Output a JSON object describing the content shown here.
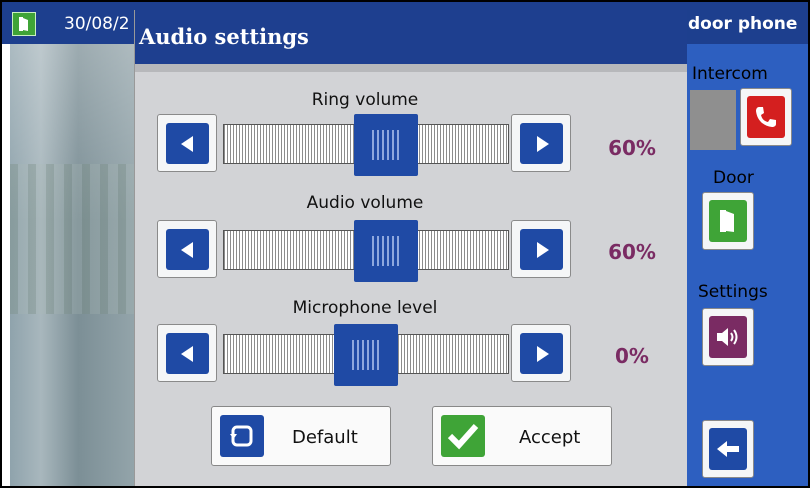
{
  "topbar": {
    "date": "30/08/2",
    "device": "door phone"
  },
  "dialog": {
    "title": "Audio settings"
  },
  "sliders": [
    {
      "label": "Ring volume",
      "value": "60%",
      "level": 0.6
    },
    {
      "label": "Audio volume",
      "value": "60%",
      "level": 0.6
    },
    {
      "label": "Microphone level",
      "value": "0%",
      "level": 0.0
    }
  ],
  "actions": {
    "default_label": "Default",
    "accept_label": "Accept"
  },
  "side": {
    "intercom_label": "Intercom",
    "door_label": "Door",
    "settings_label": "Settings"
  },
  "colors": {
    "header_blue": "#1e3f8f",
    "button_blue": "#1f4aa5",
    "percent": "#7a2b63",
    "call_red": "#d41f1f",
    "door_green": "#3fa437",
    "speaker_purple": "#7a2b63"
  },
  "icons": {
    "left": "arrow-left-icon",
    "right": "arrow-right-icon",
    "reset": "reset-icon",
    "check": "checkmark-icon",
    "phone": "phone-icon",
    "door": "door-icon",
    "speaker": "speaker-icon",
    "back": "back-arrow-icon"
  }
}
